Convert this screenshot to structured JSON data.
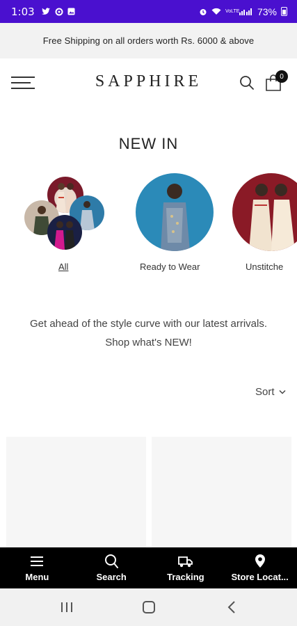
{
  "status_bar": {
    "time": "1:03",
    "battery": "73%",
    "network": "VoLTE",
    "icons_left": [
      "twitter-icon",
      "settings-icon",
      "image-icon"
    ],
    "icons_right": [
      "alarm-icon",
      "wifi-icon",
      "signal-icon",
      "battery-icon"
    ]
  },
  "announcement": {
    "text": "Free Shipping on all orders worth Rs. 6000 & above"
  },
  "header": {
    "brand": "SAPPHIRE",
    "cart_count": "0"
  },
  "page": {
    "title": "NEW IN",
    "description": "Get ahead of the style curve with our latest arrivals. Shop what's NEW!",
    "sort_label": "Sort"
  },
  "categories": [
    {
      "label": "All",
      "image": "collage of models"
    },
    {
      "label": "Ready to Wear",
      "image": "model in blue outfit"
    },
    {
      "label": "Unstitche",
      "image": "models in cream outfits"
    }
  ],
  "bottom_nav": [
    {
      "label": "Menu",
      "icon": "menu-icon"
    },
    {
      "label": "Search",
      "icon": "search-icon"
    },
    {
      "label": "Tracking",
      "icon": "truck-icon"
    },
    {
      "label": "Store Locat...",
      "icon": "location-pin-icon"
    }
  ],
  "colors": {
    "status_bar": "#4a10cf",
    "announcement_bg": "#f2f2f2",
    "nav_bg": "#000000"
  }
}
